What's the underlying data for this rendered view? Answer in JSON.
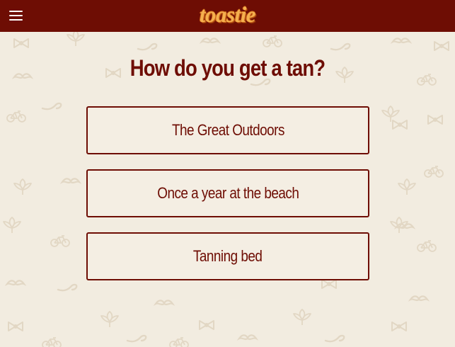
{
  "header": {
    "logo_text": "toastie",
    "menu_icon": "hamburger-menu-icon",
    "background_color": "#6e0d04",
    "logo_color": "#f4b04f"
  },
  "quiz": {
    "question": "How do you get a tan?",
    "answers": [
      {
        "label": "The Great Outdoors"
      },
      {
        "label": "Once a year at the beach"
      },
      {
        "label": "Tanning bed"
      }
    ]
  },
  "theme": {
    "page_background": "#f2ece0",
    "accent": "#6e0d04",
    "pattern_icons": [
      "pipe-icon",
      "mustache-icon",
      "bowtie-icon",
      "bicycle-icon",
      "leaf-icon"
    ]
  }
}
